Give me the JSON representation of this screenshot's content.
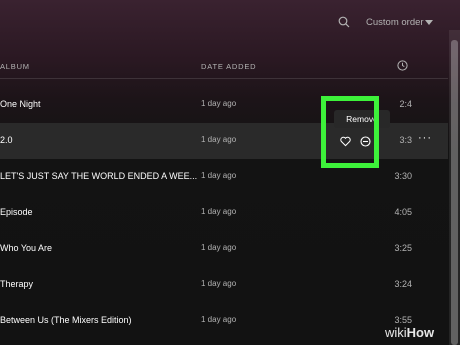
{
  "toolbar": {
    "sort_label": "Custom order"
  },
  "columns": {
    "album": "ALBUM",
    "date_added": "DATE ADDED"
  },
  "rows": [
    {
      "title": "One Night",
      "date": "1 day ago",
      "duration": "2:4"
    },
    {
      "title": "2.0",
      "date": "1 day ago",
      "duration": "3:3"
    },
    {
      "title": "LET'S JUST SAY THE WORLD ENDED A WEE...",
      "date": "1 day ago",
      "duration": "3:30"
    },
    {
      "title": "Episode",
      "date": "1 day ago",
      "duration": "4:05"
    },
    {
      "title": "Who You Are",
      "date": "1 day ago",
      "duration": "3:25"
    },
    {
      "title": "Therapy",
      "date": "1 day ago",
      "duration": "3:24"
    },
    {
      "title": "Between Us (The Mixers Edition)",
      "date": "1 day ago",
      "duration": "3:55"
    }
  ],
  "tooltip": {
    "text": "Remove"
  },
  "row_menu": {
    "more": "···"
  },
  "watermark": {
    "prefix": "wiki",
    "suffix": "How"
  },
  "colors": {
    "highlight": "#3df23a",
    "background": "#121212",
    "hover_row": "#2a2a2a"
  },
  "icons": [
    "search-icon",
    "chevron-down-icon",
    "clock-icon",
    "heart-icon",
    "remove-icon",
    "more-icon"
  ]
}
